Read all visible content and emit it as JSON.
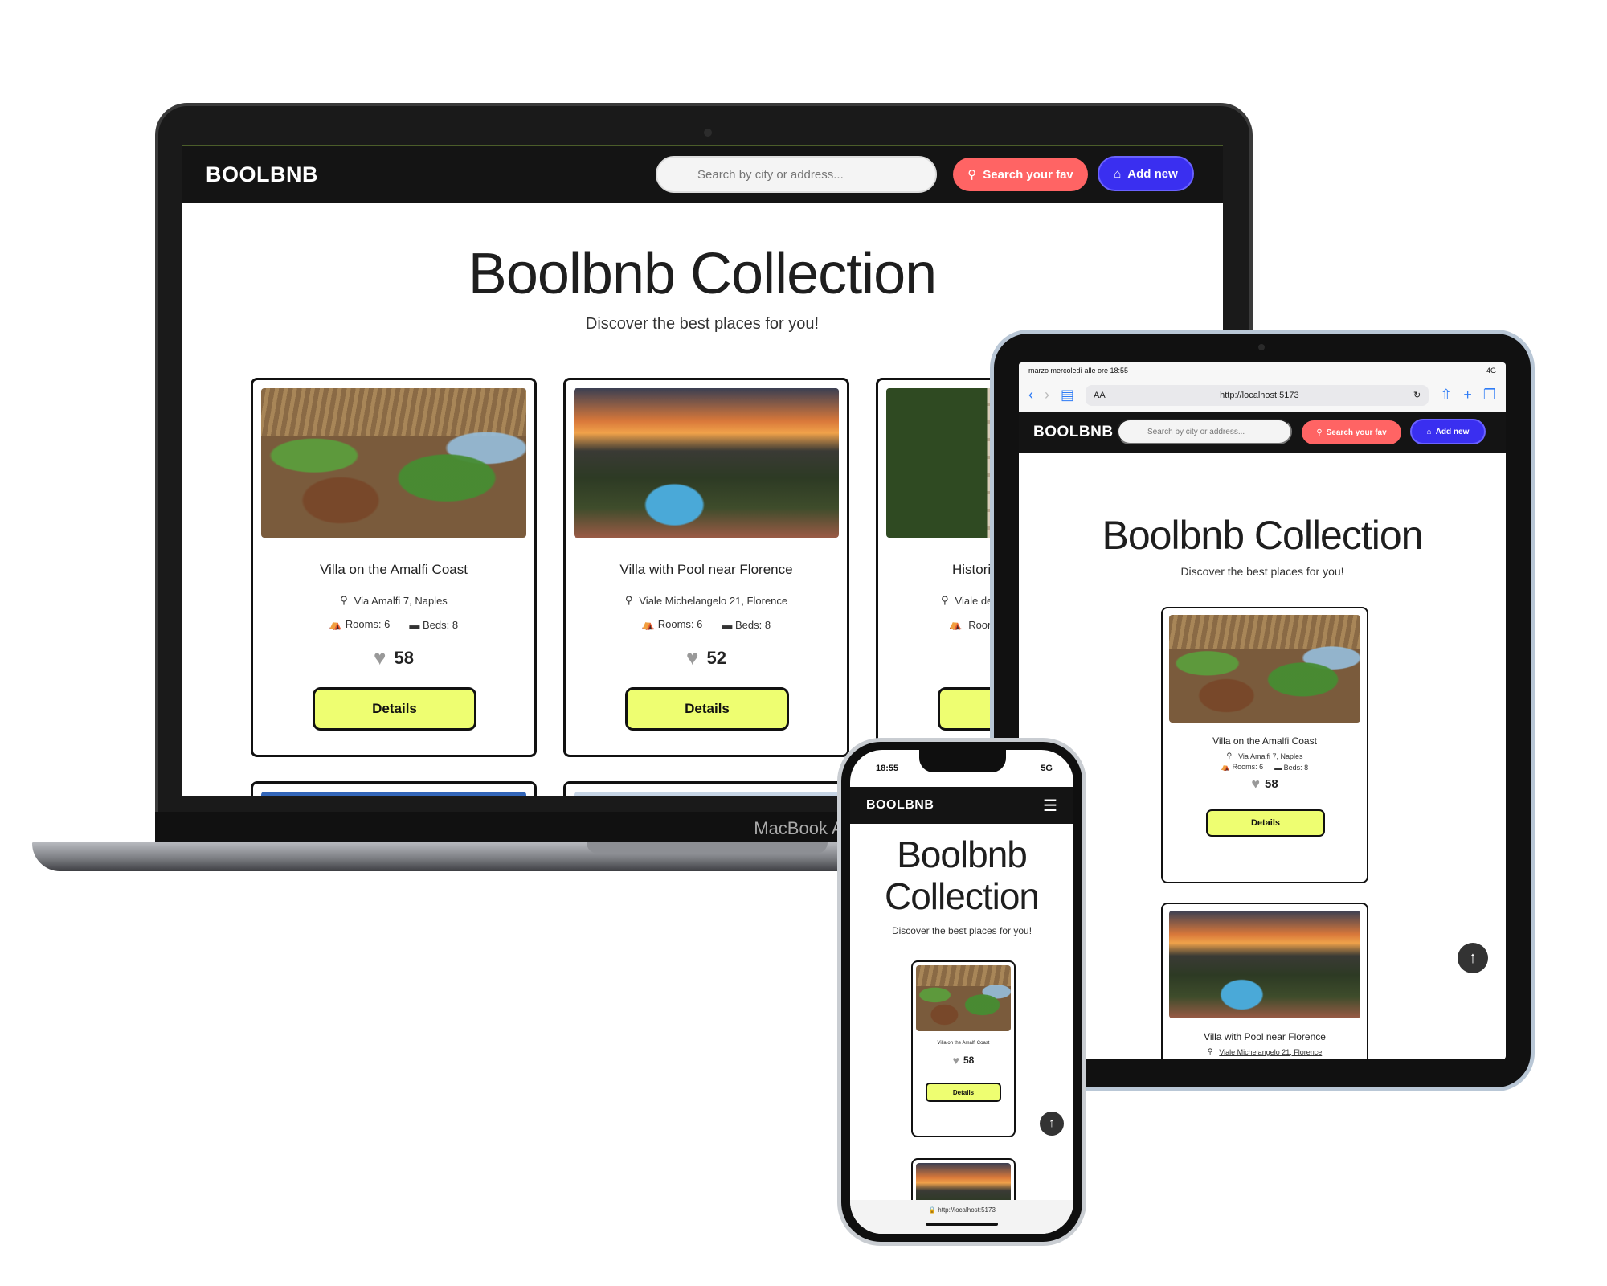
{
  "brand": "BOOLBNB",
  "search": {
    "placeholder": "Search by city or address..."
  },
  "buttons": {
    "search_fav": "Search your fav",
    "add_new": "Add new",
    "details": "Details"
  },
  "hero": {
    "title": "Boolbnb Collection",
    "subtitle": "Discover the best places for you!"
  },
  "listings": [
    {
      "title": "Villa on the Amalfi Coast",
      "address": "Via Amalfi 7, Naples",
      "rooms": "Rooms: 6",
      "beds": "Beds: 8",
      "likes": "58"
    },
    {
      "title": "Villa with Pool near Florence",
      "address": "Viale Michelangelo 21, Florence",
      "rooms": "Rooms: 6",
      "beds": "Beds: 8",
      "likes": "52"
    },
    {
      "title": "Historic",
      "address": "Viale del",
      "rooms": "Room"
    }
  ],
  "laptop": {
    "label": "MacBook Air"
  },
  "tablet": {
    "status_left": "marzo mercoledì alle ore 18:55",
    "status_right": "4G",
    "text_size": "AA",
    "url": "http://localhost:5173"
  },
  "phone": {
    "time": "18:55",
    "network": "5G",
    "url": "http://localhost:5173"
  },
  "colors": {
    "accent_lime": "#eefe71",
    "fav_red": "#ff6464",
    "add_blue": "#3a2ff0",
    "nav_dark": "#141414"
  },
  "icons": {
    "search": "search-icon",
    "home": "home-icon",
    "pin": "map-pin-icon",
    "rooms": "bank-icon",
    "beds": "bed-icon",
    "heart": "heart-icon",
    "menu": "hamburger-icon",
    "arrow_up": "arrow-up-icon"
  }
}
